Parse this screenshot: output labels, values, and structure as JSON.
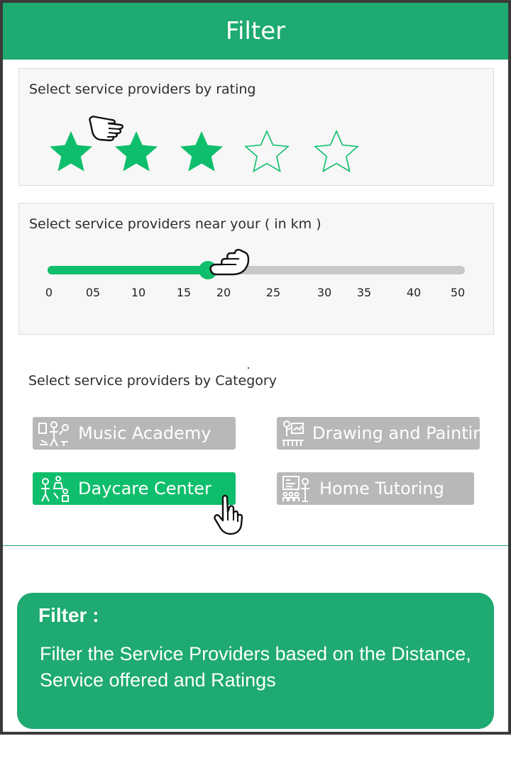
{
  "header": {
    "title": "Filter"
  },
  "rating": {
    "label": "Select service providers by rating",
    "value": 3,
    "max": 5
  },
  "distance": {
    "label": "Select service providers near your ( in km )",
    "value_km": 18,
    "ticks": [
      "0",
      "05",
      "10",
      "15",
      "20",
      "25",
      "30",
      "35",
      "40",
      "50"
    ]
  },
  "category": {
    "label": "Select service providers by Category",
    "items": [
      {
        "label": "Music Academy",
        "icon": "music-academy-icon",
        "selected": false
      },
      {
        "label": "Drawing and Painting",
        "icon": "easel-icon",
        "selected": false
      },
      {
        "label": "Daycare Center",
        "icon": "daycare-icon",
        "selected": true
      },
      {
        "label": "Home Tutoring",
        "icon": "tutoring-icon",
        "selected": false
      }
    ]
  },
  "info": {
    "title": "Filter :",
    "description": "Filter the Service Providers based on the Distance, Service offered and Ratings"
  },
  "colors": {
    "brand_green": "#1eaa70",
    "active_green": "#0fbe6c",
    "inactive_gray": "#b8b8b8"
  }
}
